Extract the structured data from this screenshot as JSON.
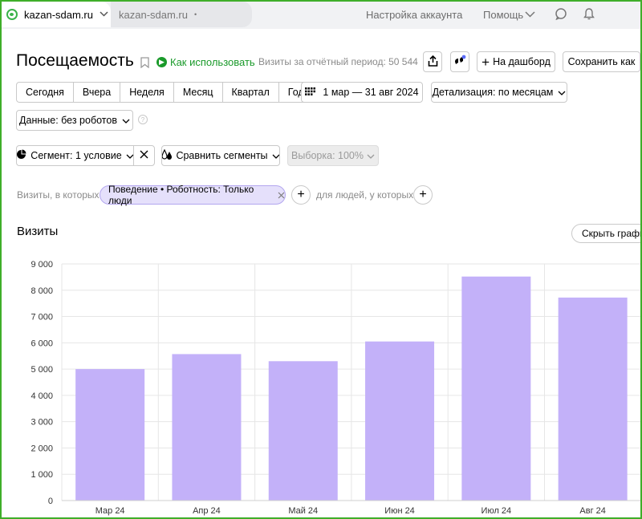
{
  "topbar": {
    "site": "kazan-sdam.ru",
    "tab2": "kazan-sdam.ru",
    "tab2_dot": "•",
    "account": "Настройка аккаунта",
    "help": "Помощь"
  },
  "header": {
    "title": "Посещаемость",
    "howto": "Как использовать",
    "visits_period": "Визиты за отчётный период: 50 544",
    "dashboard": "На дашборд",
    "save_as": "Сохранить как"
  },
  "periods": [
    "Сегодня",
    "Вчера",
    "Неделя",
    "Месяц",
    "Квартал",
    "Год"
  ],
  "date_range": "1 мар — 31 авг 2024",
  "detail": "Детализация: по месяцам",
  "data_filter": "Данные: без роботов",
  "segment": "Сегмент: 1 условие",
  "compare": "Сравнить сегменты",
  "sample": "Выборка: 100%",
  "filters": {
    "visits_label": "Визиты, в которых",
    "chip": "Поведение • Роботность: Только люди",
    "people_label": "для людей, у которых"
  },
  "chart_section": {
    "title": "Визиты",
    "hide": "Скрыть графи"
  },
  "colors": {
    "bar": "#c3b1f9",
    "accent": "#1a9a2a"
  },
  "chart_data": {
    "type": "bar",
    "categories": [
      "Мар 24",
      "Апр 24",
      "Май 24",
      "Июн 24",
      "Июл 24",
      "Авг 24"
    ],
    "values": [
      5000,
      5570,
      5300,
      6050,
      8520,
      7720
    ],
    "ylim": [
      0,
      9000
    ],
    "yticks": [
      0,
      1000,
      2000,
      3000,
      4000,
      5000,
      6000,
      7000,
      8000,
      9000
    ],
    "ytick_labels": [
      "0",
      "1 000",
      "2 000",
      "3 000",
      "4 000",
      "5 000",
      "6 000",
      "7 000",
      "8 000",
      "9 000"
    ],
    "grid": true
  }
}
